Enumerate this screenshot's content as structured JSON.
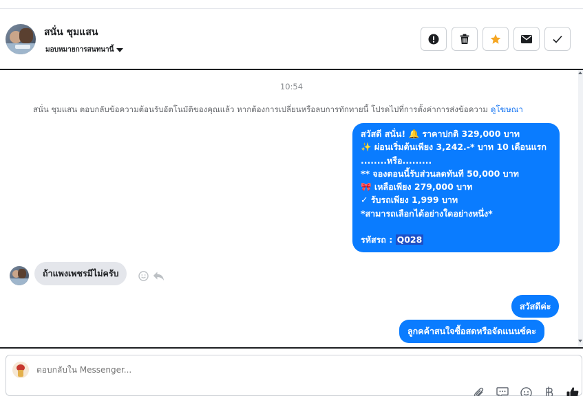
{
  "header": {
    "contact_name": "สนั่น ชุมแสน",
    "assign_label": "มอบหมายการสนทนานี้",
    "actions": [
      {
        "name": "mark-spam",
        "icon": "alert-icon"
      },
      {
        "name": "delete",
        "icon": "trash-icon"
      },
      {
        "name": "follow-up",
        "icon": "star-icon",
        "color": "#f5a623"
      },
      {
        "name": "mark-unread",
        "icon": "mail-icon"
      },
      {
        "name": "mark-done",
        "icon": "check-icon"
      }
    ]
  },
  "chat": {
    "timestamp": "10:54",
    "notice": "สนั่น ชุมแสน ตอบกลับข้อความต้อนรับอัตโนมัติของคุณแล้ว หากต้องการเปลี่ยนหรือลบการทักทายนี้ โปรดไปที่การตั้งค่าการส่งข้อความ",
    "notice_link": "ดูโฆษณา",
    "big_message": {
      "lines": [
        "สวัสดี สนั่น! 🔔  ราคาปกติ 329,000 บาท",
        "✨  ผ่อนเริ่มต้นเพียง 3,242.-* บาท 10 เดือนแรก",
        "........หรือ.........",
        "** จองตอนนี้รับส่วนลดทันที 50,000 บาท",
        "🎀  เหลือเพียง 279,000 บาท",
        "✓ รับรถเพียง 1,999 บาท",
        "*สามารถเลือกได้อย่างใดอย่างหนึ่ง*",
        ""
      ],
      "code_label": " รหัสรถ : ",
      "code_value": "Q028"
    },
    "incoming_message": "ถ้าแพงเพชรมีไม่ครับ",
    "outgoing_1": "สวัสดีค่ะ",
    "outgoing_2": "ลูกคค้าสนใจซื้อสดหรือจัดแนนซ์คะ",
    "bubble_color": "#0a7cff",
    "incoming_color": "#e4e6eb"
  },
  "composer": {
    "placeholder": "ตอบกลับใน Messenger...",
    "tools": [
      "paperclip-icon",
      "saved-reply-icon",
      "emoji-icon",
      "baht-icon",
      "thumbs-up-icon"
    ]
  }
}
